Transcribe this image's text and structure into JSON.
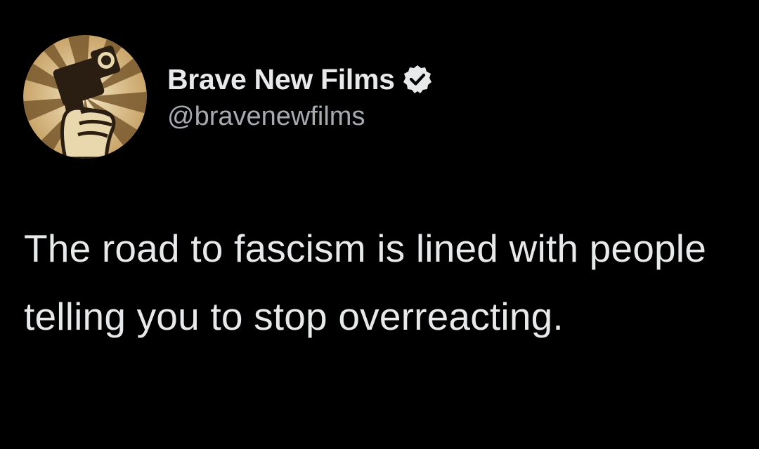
{
  "tweet": {
    "author": {
      "display_name": "Brave New Films",
      "handle": "@bravenewfilms",
      "verified": true,
      "verified_icon": "verified-badge-icon",
      "avatar_icon": "camera-fist-logo-icon"
    },
    "text": "The road to fascism is lined with people telling you to stop overreacting."
  },
  "colors": {
    "background": "#000000",
    "text_primary": "#e7e9ea",
    "text_secondary": "#a6abb0",
    "avatar_sunburst_light": "#e9d7ad",
    "avatar_sunburst_dark": "#7a5a2e"
  }
}
